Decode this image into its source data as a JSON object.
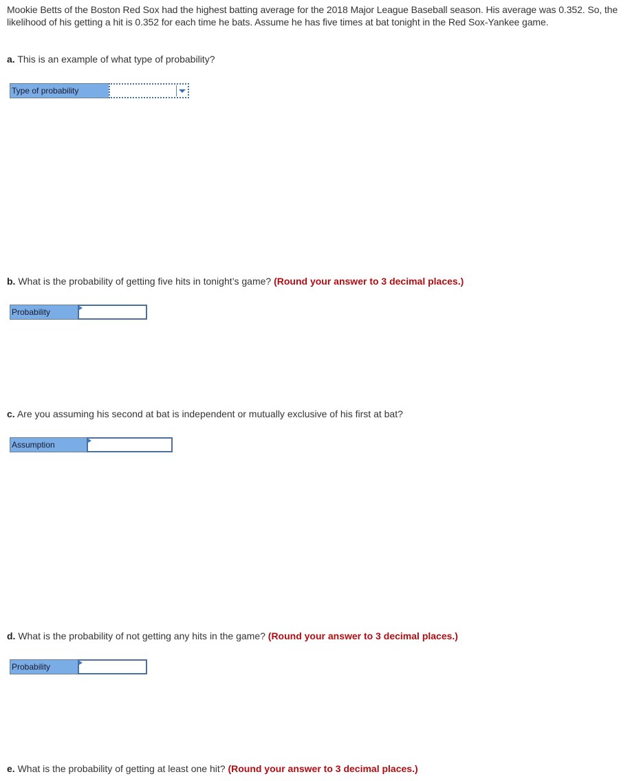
{
  "problem": {
    "intro": "Mookie Betts of the Boston Red Sox had the highest batting average for the 2018 Major League Baseball season. His average was 0.352. So, the likelihood of his getting a hit is 0.352 for each time he bats. Assume he has five times at bat tonight in the Red Sox-Yankee game."
  },
  "questions": [
    {
      "letter": "a.",
      "text": "This is an example of what type of probability?",
      "round_note": "",
      "widget": {
        "type": "dropdown",
        "label": "Type of probability",
        "value": ""
      }
    },
    {
      "letter": "b.",
      "text": "What is the probability of getting five hits in tonight’s game?",
      "round_note": "(Round your answer to 3 decimal places.)",
      "widget": {
        "type": "input",
        "label": "Probability",
        "value": ""
      }
    },
    {
      "letter": "c.",
      "text": "Are you assuming his second at bat is independent or mutually exclusive of his first at bat?",
      "round_note": "",
      "widget": {
        "type": "input",
        "label": "Assumption",
        "value": ""
      }
    },
    {
      "letter": "d.",
      "text": "What is the probability of not getting any hits in the game?",
      "round_note": "(Round your answer to 3 decimal places.)",
      "widget": {
        "type": "input",
        "label": "Probability",
        "value": ""
      }
    },
    {
      "letter": "e.",
      "text": "What is the probability of getting at least one hit?",
      "round_note": "(Round your answer to 3 decimal places.)"
    }
  ],
  "colors": {
    "label_bg": "#7aade6",
    "field_border": "#4a6fa0",
    "round_note": "#b00d12"
  }
}
